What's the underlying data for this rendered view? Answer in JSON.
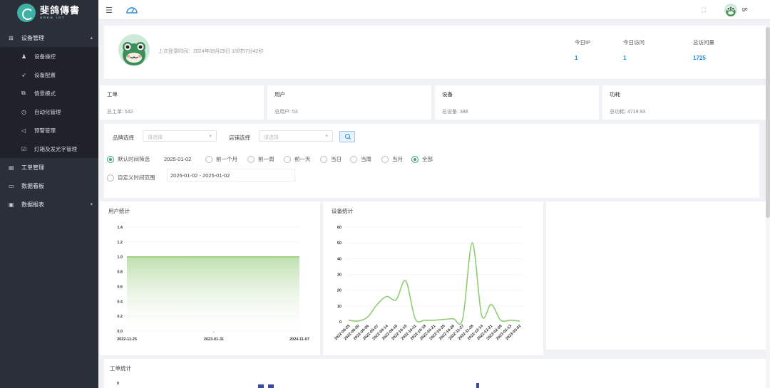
{
  "brand": {
    "title": "斐鸽傳書",
    "subtitle": "GREN IOT"
  },
  "sidebar": {
    "groups": [
      {
        "label": "设备管理",
        "icon": "grid-icon",
        "expanded": true,
        "items": [
          {
            "label": "设备操控",
            "icon": "bell-icon"
          },
          {
            "label": "设备配置",
            "icon": "rocket-icon"
          },
          {
            "label": "情景模式",
            "icon": "copy-icon"
          },
          {
            "label": "自动化管理",
            "icon": "clock-icon"
          },
          {
            "label": "预警管理",
            "icon": "speaker-icon"
          },
          {
            "label": "灯箱及发光字管理",
            "icon": "checkbox-icon"
          }
        ]
      },
      {
        "label": "工单管理",
        "icon": "calendar-icon"
      },
      {
        "label": "数据看板",
        "icon": "monitor-icon"
      },
      {
        "label": "数据报表",
        "icon": "report-icon"
      }
    ]
  },
  "topbar": {
    "username": "ge"
  },
  "welcome": {
    "last_login": "上次登录时间：2024年09月29日 10时57分42秒",
    "stats": [
      {
        "label": "今日IP",
        "value": "1"
      },
      {
        "label": "今日访问",
        "value": "1"
      },
      {
        "label": "总访问量",
        "value": "1725"
      }
    ]
  },
  "cards": [
    {
      "title": "工单",
      "value": "总工单: 542"
    },
    {
      "title": "用户",
      "value": "总用户: 53"
    },
    {
      "title": "设备",
      "value": "总设备: 388"
    },
    {
      "title": "功耗",
      "value": "总功耗: 4719.93"
    }
  ],
  "filter": {
    "brand_label": "品牌选择",
    "brand_placeholder": "请选择",
    "store_label": "店铺选择",
    "store_placeholder": "请选择",
    "default_range_label": "默认时间筛选",
    "default_date": "2025-01-02",
    "quick_options": [
      "前一个月",
      "前一周",
      "前一天",
      "当日",
      "当周",
      "当月",
      "全部"
    ],
    "selected_option": "全部",
    "custom_range_label": "自定义时间范围",
    "custom_range_value": "2025-01-02 - 2025-01-02"
  },
  "colors": {
    "accent": "#3aa676",
    "link": "#2a8bd6",
    "sidebar_bg": "#2b2f3a",
    "line": "#91cc75"
  },
  "chart_data": [
    {
      "type": "area",
      "title": "用户统计",
      "x_tick_labels": [
        "2022-11-25",
        "2023-01-31",
        "2024-11-07"
      ],
      "y_ticks": [
        0.0,
        0.2,
        0.4,
        0.6,
        0.8,
        1.0,
        1.2,
        1.4
      ],
      "ylim": [
        0,
        1.4
      ],
      "series": [
        {
          "values": [
            1.0,
            1.0,
            1.0
          ]
        }
      ]
    },
    {
      "type": "line",
      "title": "设备统计",
      "categories": [
        "2022-08-25",
        "2022-08-30",
        "2022-09-06",
        "2022-09-07",
        "2022-09-14",
        "2022-09-19",
        "2022-10-10",
        "2022-10-11",
        "2022-10-18",
        "2022-10-21",
        "2022-10-25",
        "2022-10-26",
        "2022-11-27",
        "2022-11-28",
        "2022-12-14",
        "2022-12-21",
        "2023-02-09",
        "2023-02-13",
        "2023-03-02"
      ],
      "ylim": [
        0,
        60
      ],
      "y_ticks": [
        0,
        10,
        20,
        30,
        40,
        50,
        60
      ],
      "series": [
        {
          "values": [
            1,
            0.5,
            3,
            11,
            16,
            14,
            26,
            2,
            1,
            1,
            1.5,
            2,
            2,
            50,
            4,
            11,
            1,
            1,
            0.5
          ]
        }
      ]
    }
  ],
  "bottom_chart": {
    "title": "工单统计",
    "y_start": "0"
  }
}
